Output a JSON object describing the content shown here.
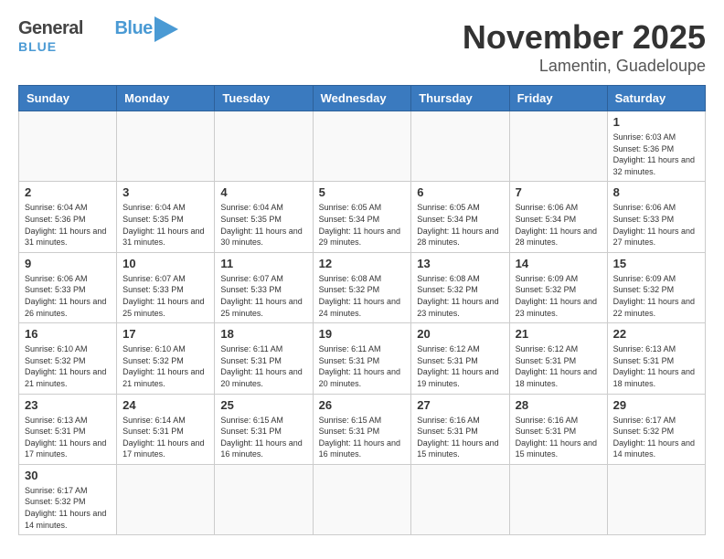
{
  "header": {
    "logo_general": "General",
    "logo_blue": "Blue",
    "title": "November 2025",
    "subtitle": "Lamentin, Guadeloupe"
  },
  "calendar": {
    "days_of_week": [
      "Sunday",
      "Monday",
      "Tuesday",
      "Wednesday",
      "Thursday",
      "Friday",
      "Saturday"
    ],
    "weeks": [
      [
        {
          "day": "",
          "info": ""
        },
        {
          "day": "",
          "info": ""
        },
        {
          "day": "",
          "info": ""
        },
        {
          "day": "",
          "info": ""
        },
        {
          "day": "",
          "info": ""
        },
        {
          "day": "",
          "info": ""
        },
        {
          "day": "1",
          "info": "Sunrise: 6:03 AM\nSunset: 5:36 PM\nDaylight: 11 hours\nand 32 minutes."
        }
      ],
      [
        {
          "day": "2",
          "info": "Sunrise: 6:04 AM\nSunset: 5:36 PM\nDaylight: 11 hours\nand 31 minutes."
        },
        {
          "day": "3",
          "info": "Sunrise: 6:04 AM\nSunset: 5:35 PM\nDaylight: 11 hours\nand 31 minutes."
        },
        {
          "day": "4",
          "info": "Sunrise: 6:04 AM\nSunset: 5:35 PM\nDaylight: 11 hours\nand 30 minutes."
        },
        {
          "day": "5",
          "info": "Sunrise: 6:05 AM\nSunset: 5:34 PM\nDaylight: 11 hours\nand 29 minutes."
        },
        {
          "day": "6",
          "info": "Sunrise: 6:05 AM\nSunset: 5:34 PM\nDaylight: 11 hours\nand 28 minutes."
        },
        {
          "day": "7",
          "info": "Sunrise: 6:06 AM\nSunset: 5:34 PM\nDaylight: 11 hours\nand 28 minutes."
        },
        {
          "day": "8",
          "info": "Sunrise: 6:06 AM\nSunset: 5:33 PM\nDaylight: 11 hours\nand 27 minutes."
        }
      ],
      [
        {
          "day": "9",
          "info": "Sunrise: 6:06 AM\nSunset: 5:33 PM\nDaylight: 11 hours\nand 26 minutes."
        },
        {
          "day": "10",
          "info": "Sunrise: 6:07 AM\nSunset: 5:33 PM\nDaylight: 11 hours\nand 25 minutes."
        },
        {
          "day": "11",
          "info": "Sunrise: 6:07 AM\nSunset: 5:33 PM\nDaylight: 11 hours\nand 25 minutes."
        },
        {
          "day": "12",
          "info": "Sunrise: 6:08 AM\nSunset: 5:32 PM\nDaylight: 11 hours\nand 24 minutes."
        },
        {
          "day": "13",
          "info": "Sunrise: 6:08 AM\nSunset: 5:32 PM\nDaylight: 11 hours\nand 23 minutes."
        },
        {
          "day": "14",
          "info": "Sunrise: 6:09 AM\nSunset: 5:32 PM\nDaylight: 11 hours\nand 23 minutes."
        },
        {
          "day": "15",
          "info": "Sunrise: 6:09 AM\nSunset: 5:32 PM\nDaylight: 11 hours\nand 22 minutes."
        }
      ],
      [
        {
          "day": "16",
          "info": "Sunrise: 6:10 AM\nSunset: 5:32 PM\nDaylight: 11 hours\nand 21 minutes."
        },
        {
          "day": "17",
          "info": "Sunrise: 6:10 AM\nSunset: 5:32 PM\nDaylight: 11 hours\nand 21 minutes."
        },
        {
          "day": "18",
          "info": "Sunrise: 6:11 AM\nSunset: 5:31 PM\nDaylight: 11 hours\nand 20 minutes."
        },
        {
          "day": "19",
          "info": "Sunrise: 6:11 AM\nSunset: 5:31 PM\nDaylight: 11 hours\nand 20 minutes."
        },
        {
          "day": "20",
          "info": "Sunrise: 6:12 AM\nSunset: 5:31 PM\nDaylight: 11 hours\nand 19 minutes."
        },
        {
          "day": "21",
          "info": "Sunrise: 6:12 AM\nSunset: 5:31 PM\nDaylight: 11 hours\nand 18 minutes."
        },
        {
          "day": "22",
          "info": "Sunrise: 6:13 AM\nSunset: 5:31 PM\nDaylight: 11 hours\nand 18 minutes."
        }
      ],
      [
        {
          "day": "23",
          "info": "Sunrise: 6:13 AM\nSunset: 5:31 PM\nDaylight: 11 hours\nand 17 minutes."
        },
        {
          "day": "24",
          "info": "Sunrise: 6:14 AM\nSunset: 5:31 PM\nDaylight: 11 hours\nand 17 minutes."
        },
        {
          "day": "25",
          "info": "Sunrise: 6:15 AM\nSunset: 5:31 PM\nDaylight: 11 hours\nand 16 minutes."
        },
        {
          "day": "26",
          "info": "Sunrise: 6:15 AM\nSunset: 5:31 PM\nDaylight: 11 hours\nand 16 minutes."
        },
        {
          "day": "27",
          "info": "Sunrise: 6:16 AM\nSunset: 5:31 PM\nDaylight: 11 hours\nand 15 minutes."
        },
        {
          "day": "28",
          "info": "Sunrise: 6:16 AM\nSunset: 5:31 PM\nDaylight: 11 hours\nand 15 minutes."
        },
        {
          "day": "29",
          "info": "Sunrise: 6:17 AM\nSunset: 5:32 PM\nDaylight: 11 hours\nand 14 minutes."
        }
      ],
      [
        {
          "day": "30",
          "info": "Sunrise: 6:17 AM\nSunset: 5:32 PM\nDaylight: 11 hours\nand 14 minutes."
        },
        {
          "day": "",
          "info": ""
        },
        {
          "day": "",
          "info": ""
        },
        {
          "day": "",
          "info": ""
        },
        {
          "day": "",
          "info": ""
        },
        {
          "day": "",
          "info": ""
        },
        {
          "day": "",
          "info": ""
        }
      ]
    ]
  }
}
